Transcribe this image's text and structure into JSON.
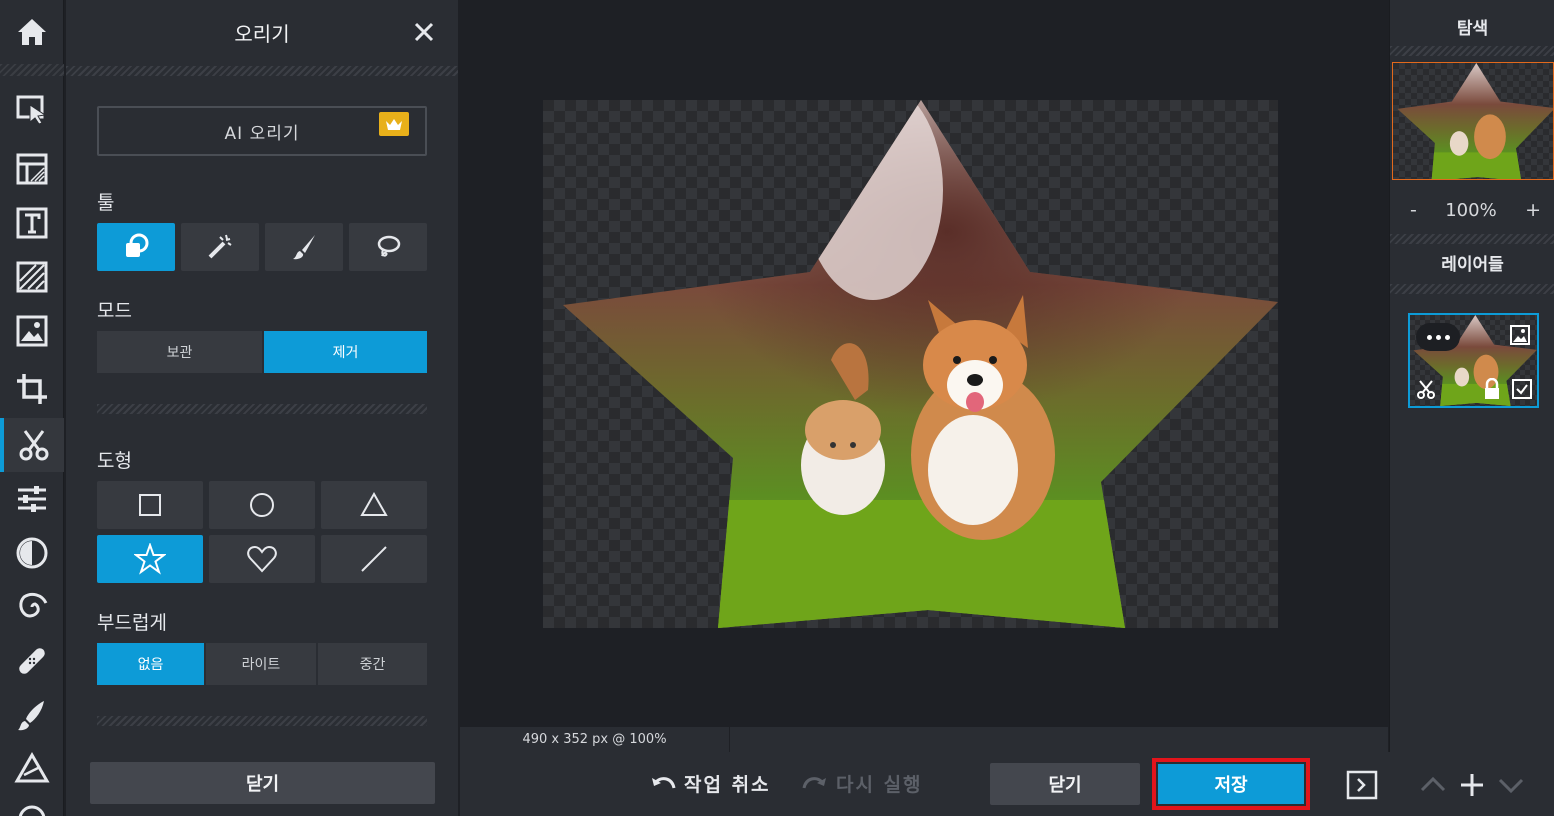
{
  "panel": {
    "title": "오리기",
    "ai_button": "AI 오리기",
    "tools_label": "툴",
    "mode_label": "모드",
    "mode_options": [
      "보관",
      "제거"
    ],
    "mode_selected": "제거",
    "shape_label": "도형",
    "shapes": [
      "square",
      "circle",
      "triangle",
      "star",
      "heart",
      "line"
    ],
    "shape_selected": "star",
    "feather_label": "부드럽게",
    "feather_options": [
      "없음",
      "라이트",
      "중간"
    ],
    "feather_selected": "없음",
    "close_button": "닫기"
  },
  "toolbar": {
    "items": [
      "home-icon",
      "arrange-icon",
      "layout-icon",
      "text-icon",
      "pattern-icon",
      "image-icon",
      "crop-icon",
      "cutout-icon",
      "adjust-icon",
      "filter-icon",
      "effect-swirl-icon",
      "heal-icon",
      "brush-icon",
      "draw-icon"
    ],
    "active": "cutout-icon"
  },
  "canvas": {
    "dimensions": "490 x 352 px @ 100%"
  },
  "bottombar": {
    "undo": "작업 취소",
    "redo": "다시 실행",
    "close": "닫기",
    "save": "저장"
  },
  "rightpanel": {
    "navigator_title": "탐색",
    "zoom_minus": "-",
    "zoom_value": "100%",
    "zoom_plus": "+",
    "layers_title": "레이어들"
  },
  "colors": {
    "accent": "#0d9bd7",
    "highlight": "#e3141b",
    "panel_bg": "#2a2d33"
  }
}
